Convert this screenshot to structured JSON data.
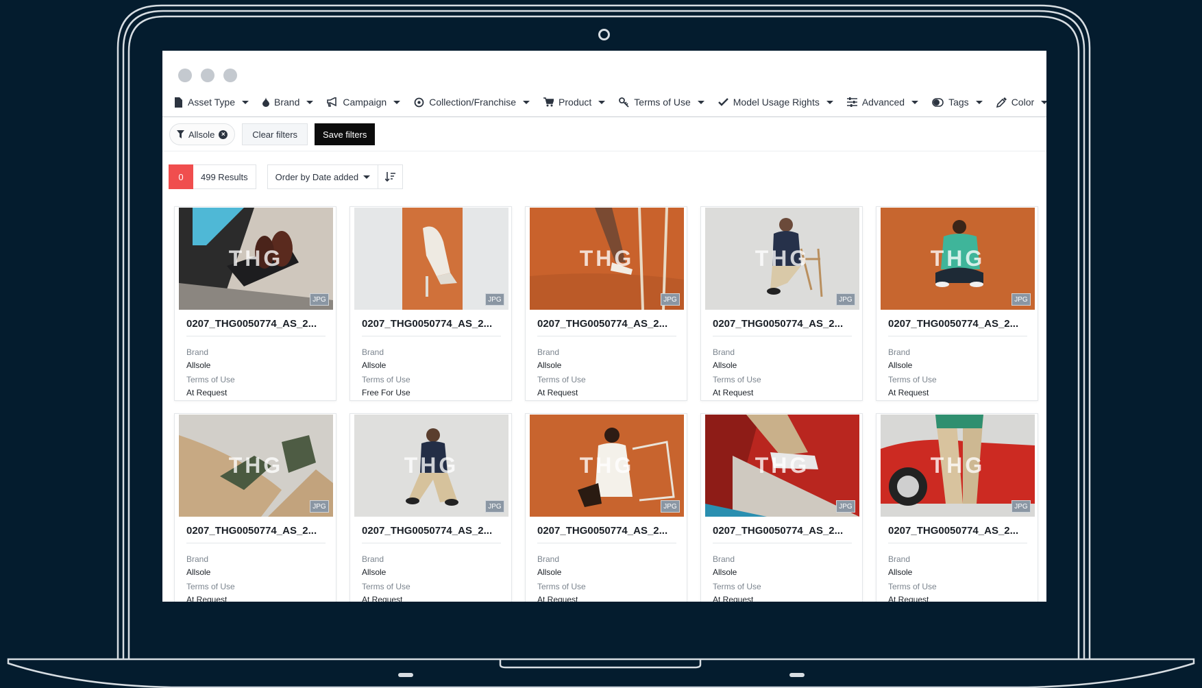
{
  "window": {
    "dots": [
      "close",
      "minimize",
      "maximize"
    ]
  },
  "menu": [
    {
      "label": "Asset Type",
      "icon": "file-icon"
    },
    {
      "label": "Brand",
      "icon": "droplet-icon"
    },
    {
      "label": "Campaign",
      "icon": "bullhorn-icon"
    },
    {
      "label": "Collection/Franchise",
      "icon": "target-icon"
    },
    {
      "label": "Product",
      "icon": "cart-icon"
    },
    {
      "label": "Terms of Use",
      "icon": "key-icon"
    },
    {
      "label": "Model Usage Rights",
      "icon": "check-icon"
    },
    {
      "label": "Advanced",
      "icon": "sliders-icon"
    },
    {
      "label": "Tags",
      "icon": "toggle-icon"
    },
    {
      "label": "Color",
      "icon": "eyedropper-icon"
    }
  ],
  "filters": {
    "active_chip": "Allsole",
    "clear_label": "Clear filters",
    "save_label": "Save filters"
  },
  "results": {
    "selected_count": "0",
    "results_label": "499 Results",
    "order_label": "Order by Date added"
  },
  "card_labels": {
    "brand": "Brand",
    "terms": "Terms of Use",
    "file_type": "JPG",
    "watermark": "THG"
  },
  "assets": [
    {
      "title": "0207_THG0050774_AS_2...",
      "brand": "Allsole",
      "terms": "At Request"
    },
    {
      "title": "0207_THG0050774_AS_2...",
      "brand": "Allsole",
      "terms": "Free For Use"
    },
    {
      "title": "0207_THG0050774_AS_2...",
      "brand": "Allsole",
      "terms": "At Request"
    },
    {
      "title": "0207_THG0050774_AS_2...",
      "brand": "Allsole",
      "terms": "At Request"
    },
    {
      "title": "0207_THG0050774_AS_2...",
      "brand": "Allsole",
      "terms": "At Request"
    },
    {
      "title": "0207_THG0050774_AS_2...",
      "brand": "Allsole",
      "terms": "At Request"
    },
    {
      "title": "0207_THG0050774_AS_2...",
      "brand": "Allsole",
      "terms": "At Request"
    },
    {
      "title": "0207_THG0050774_AS_2...",
      "brand": "Allsole",
      "terms": "At Request"
    },
    {
      "title": "0207_THG0050774_AS_2...",
      "brand": "Allsole",
      "terms": "At Request"
    },
    {
      "title": "0207_THG0050774_AS_2...",
      "brand": "Allsole",
      "terms": "At Request"
    }
  ],
  "colors": {
    "accent_red": "#f04e4e",
    "bg": "#041c2e",
    "dark_button": "#0c0c0c"
  }
}
